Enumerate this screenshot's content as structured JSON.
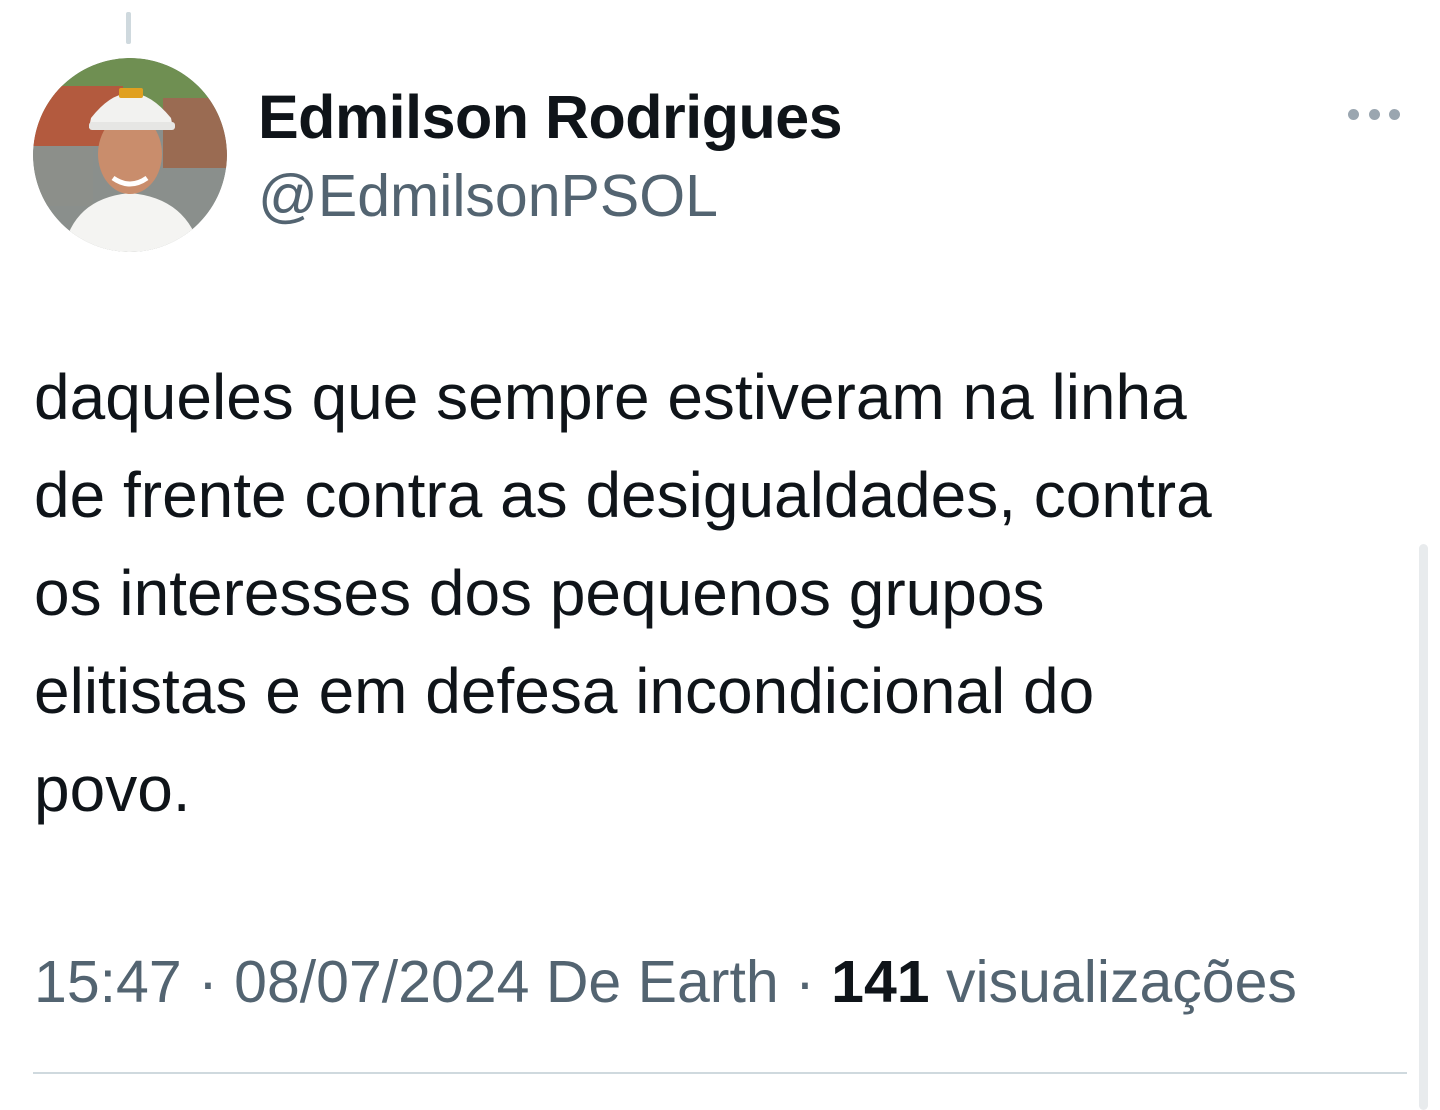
{
  "tweet": {
    "author": {
      "display_name": "Edmilson Rodrigues",
      "handle": "@EdmilsonPSOL"
    },
    "text": "daqueles que sempre estiveram na linha\nde frente contra as desigualdades, contra\nos interesses dos pequenos grupos\nelitistas e em defesa incondicional do\npovo.",
    "time": "15:47",
    "date": "08/07/2024",
    "source": "De Earth",
    "separator": "·",
    "views_count": "141",
    "views_label": "visualizações"
  },
  "icons": {
    "more": "more-horizontal-icon"
  },
  "colors": {
    "text_primary": "#0f1419",
    "text_secondary": "#536471",
    "divider": "#cfd9de"
  }
}
